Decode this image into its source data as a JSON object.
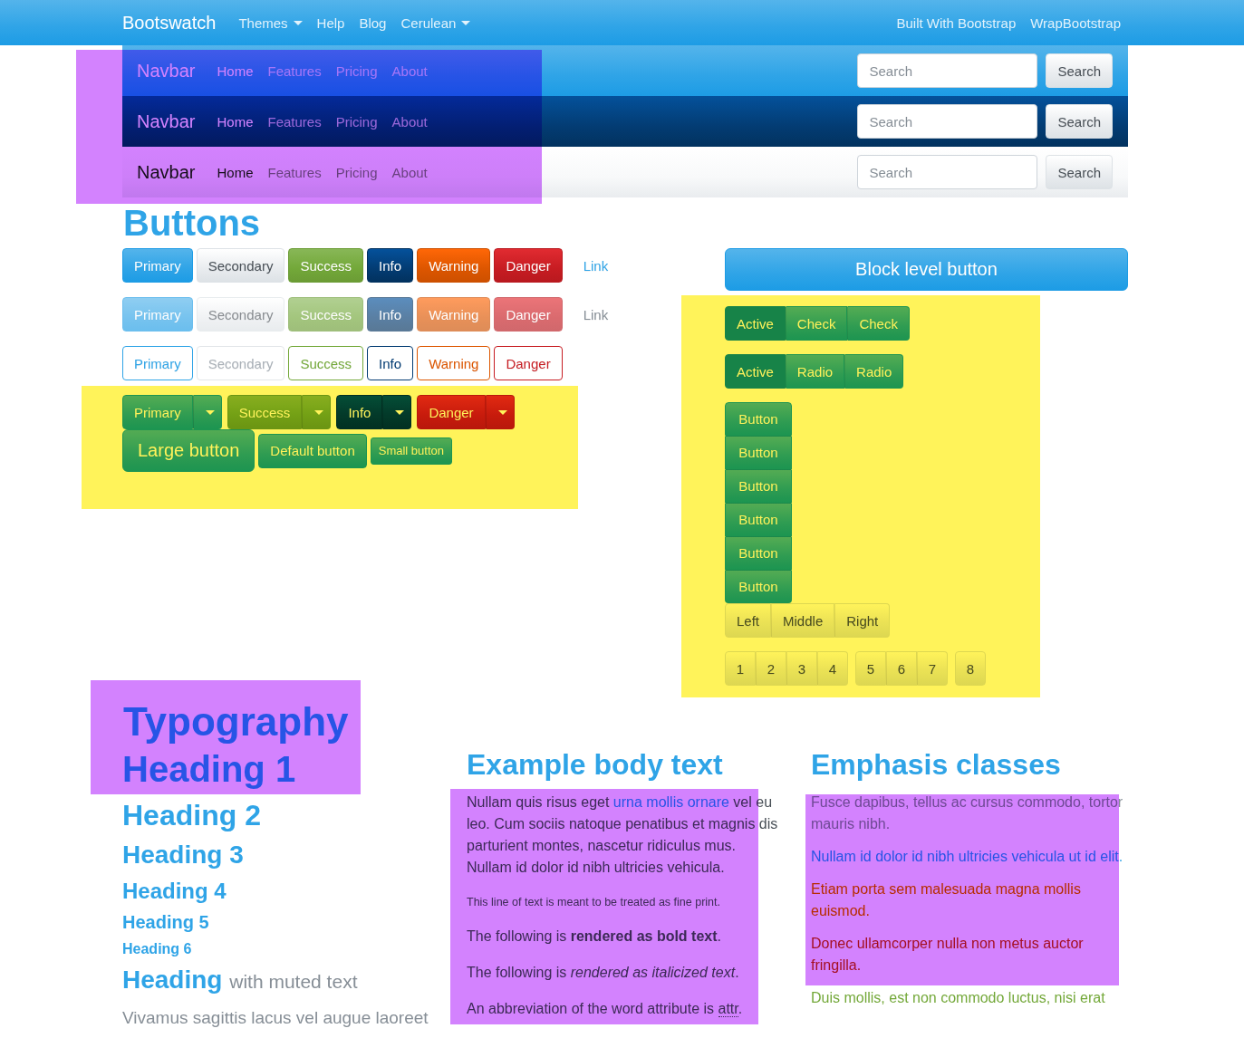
{
  "top_nav": {
    "brand": "Bootswatch",
    "items": [
      {
        "label": "Themes",
        "dropdown": true
      },
      {
        "label": "Help",
        "dropdown": false
      },
      {
        "label": "Blog",
        "dropdown": false
      },
      {
        "label": "Cerulean",
        "dropdown": true
      }
    ],
    "right_items": [
      {
        "label": "Built With Bootstrap"
      },
      {
        "label": "WrapBootstrap"
      }
    ]
  },
  "navbar_examples": {
    "highlight": {
      "color": "#d382fe"
    },
    "navbars": [
      {
        "kind": "primary",
        "brand": "Navbar",
        "links": [
          {
            "label": "Home",
            "selected": true
          },
          {
            "label": "Features",
            "selected": false
          },
          {
            "label": "Pricing",
            "selected": false
          },
          {
            "label": "About",
            "selected": false
          }
        ],
        "search": {
          "placeholder": "Search"
        },
        "button": "Search"
      },
      {
        "kind": "dark",
        "brand": "Navbar",
        "links": [
          {
            "label": "Home",
            "selected": true
          },
          {
            "label": "Features",
            "selected": false
          },
          {
            "label": "Pricing",
            "selected": false
          },
          {
            "label": "About",
            "selected": false
          }
        ],
        "search": {
          "placeholder": "Search"
        },
        "button": "Search"
      },
      {
        "kind": "light",
        "brand": "Navbar",
        "links": [
          {
            "label": "Home",
            "selected": true
          },
          {
            "label": "Features",
            "selected": false
          },
          {
            "label": "Pricing",
            "selected": false
          },
          {
            "label": "About",
            "selected": false
          }
        ],
        "search": {
          "placeholder": "Search"
        },
        "button": "Search"
      }
    ]
  },
  "buttons": {
    "heading": "Buttons",
    "rows": [
      {
        "kind": "solid",
        "disabled": false,
        "buttons": [
          {
            "label": "Primary",
            "kind": "primary"
          },
          {
            "label": "Secondary",
            "kind": "secondary"
          },
          {
            "label": "Success",
            "kind": "success"
          },
          {
            "label": "Info",
            "kind": "info"
          },
          {
            "label": "Warning",
            "kind": "warning"
          },
          {
            "label": "Danger",
            "kind": "danger"
          },
          {
            "label": "Link",
            "kind": "link"
          }
        ]
      },
      {
        "kind": "solid",
        "disabled": true,
        "buttons": [
          {
            "label": "Primary",
            "kind": "primary"
          },
          {
            "label": "Secondary",
            "kind": "secondary"
          },
          {
            "label": "Success",
            "kind": "success"
          },
          {
            "label": "Info",
            "kind": "info"
          },
          {
            "label": "Warning",
            "kind": "warning"
          },
          {
            "label": "Danger",
            "kind": "danger"
          },
          {
            "label": "Link",
            "kind": "link"
          }
        ]
      },
      {
        "kind": "outline",
        "disabled": false,
        "buttons": [
          {
            "label": "Primary",
            "kind": "primary"
          },
          {
            "label": "Secondary",
            "kind": "secondary"
          },
          {
            "label": "Success",
            "kind": "success"
          },
          {
            "label": "Info",
            "kind": "info"
          },
          {
            "label": "Warning",
            "kind": "warning"
          },
          {
            "label": "Danger",
            "kind": "danger"
          }
        ]
      }
    ],
    "dropdown_area": {
      "highlight": {
        "color": "#fff35a"
      },
      "split_buttons": [
        {
          "label": "Primary",
          "kind": "primary"
        },
        {
          "label": "Success",
          "kind": "success"
        },
        {
          "label": "Info",
          "kind": "info"
        },
        {
          "label": "Danger",
          "kind": "danger"
        }
      ],
      "sizes": [
        {
          "label": "Large button",
          "kind": "large"
        },
        {
          "label": "Default button",
          "kind": "default"
        },
        {
          "label": "Small button",
          "kind": "small"
        }
      ]
    },
    "block_button": "Block level button",
    "group_area": {
      "highlight": {
        "color": "#fff35a"
      },
      "checkbox_group": [
        {
          "label": "Active",
          "checked": true
        },
        {
          "label": "Check",
          "checked": false
        },
        {
          "label": "Check",
          "checked": false
        }
      ],
      "radio_group": [
        {
          "label": "Active",
          "selected": true
        },
        {
          "label": "Radio",
          "selected": false
        },
        {
          "label": "Radio",
          "selected": false
        }
      ],
      "vertical_group": [
        "Button",
        "Button",
        "Button",
        "Button",
        "Button",
        "Button"
      ],
      "alignment_group": [
        "Left",
        "Middle",
        "Right"
      ],
      "toolbar": [
        [
          "1",
          "2",
          "3",
          "4"
        ],
        [
          "5",
          "6",
          "7"
        ],
        [
          "8"
        ]
      ]
    }
  },
  "typography": {
    "title": "Typography",
    "highlight": {
      "color": "#d382fe"
    },
    "headings": [
      {
        "kind": "h1",
        "text": "Heading 1"
      },
      {
        "kind": "h2",
        "text": "Heading 2"
      },
      {
        "kind": "h3",
        "text": "Heading 3"
      },
      {
        "kind": "h4",
        "text": "Heading 4"
      },
      {
        "kind": "h5",
        "text": "Heading 5"
      },
      {
        "kind": "h6",
        "text": "Heading 6"
      }
    ],
    "muted_heading": {
      "text": "Heading",
      "muted": "with muted text"
    },
    "lead": "Vivamus sagittis lacus vel augue laoreet"
  },
  "body_text": {
    "heading": "Example body text",
    "highlight": {
      "color": "#d382fe"
    },
    "paragraphs": [
      {
        "kind": "link",
        "before": "Nullam quis risus eget ",
        "link": "urna mollis ornare",
        "after": " vel eu leo. Cum sociis natoque penatibus et magnis dis parturient montes, nascetur ridiculus mus. Nullam id dolor id nibh ultricies vehicula."
      },
      {
        "kind": "small",
        "text": "This line of text is meant to be treated as fine print."
      },
      {
        "kind": "plain",
        "text": "The following is **rendered as bold text**."
      },
      {
        "kind": "plain",
        "text": "The following is *rendered as italicized text*."
      },
      {
        "kind": "abbr",
        "before": "An abbreviation of the word attribute is ",
        "abbr": "attr",
        "after": "."
      }
    ]
  },
  "emphasis": {
    "heading": "Emphasis classes",
    "highlight": {
      "color": "#d382fe"
    },
    "paragraphs": [
      {
        "kind": "muted",
        "text": "Fusce dapibus, tellus ac cursus commodo, tortor mauris nibh."
      },
      {
        "kind": "primary",
        "text": "Nullam id dolor id nibh ultricies vehicula ut id elit."
      },
      {
        "kind": "warning",
        "text": "Etiam porta sem malesuada magna mollis euismod."
      },
      {
        "kind": "danger",
        "text": "Donec ullamcorper nulla non metus auctor fringilla."
      },
      {
        "kind": "success",
        "text": "Duis mollis, est non commodo luctus, nisi erat"
      }
    ]
  }
}
